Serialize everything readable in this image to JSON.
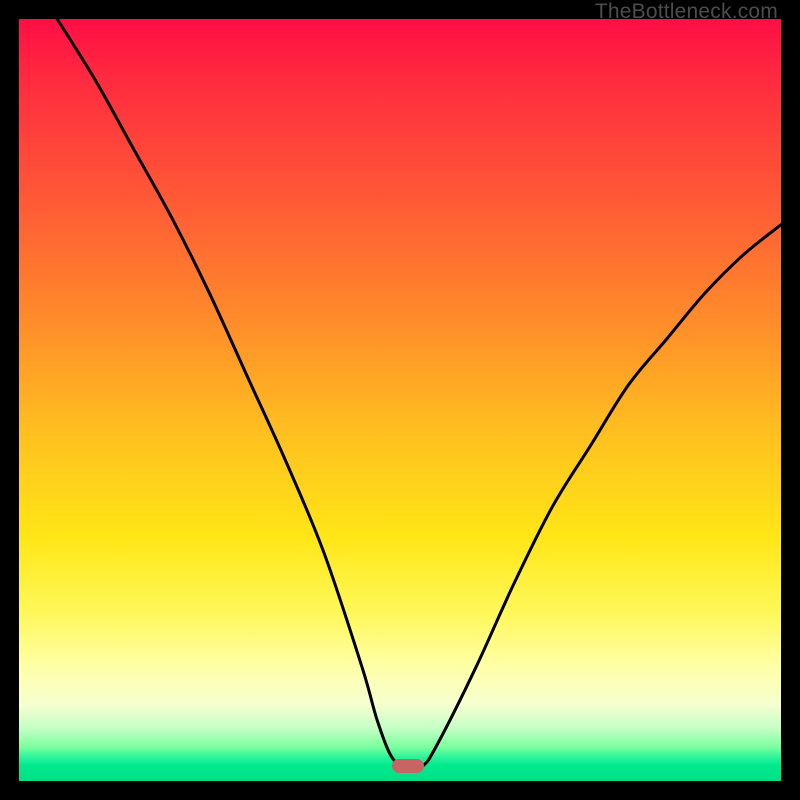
{
  "watermark": "TheBottleneck.com",
  "colors": {
    "frame": "#000000",
    "curve": "#000000",
    "marker": "#c86464",
    "gradient_top": "#ff0e45",
    "gradient_bottom": "#00e085"
  },
  "chart_data": {
    "type": "line",
    "title": "",
    "xlabel": "",
    "ylabel": "",
    "xlim": [
      0,
      100
    ],
    "ylim": [
      0,
      100
    ],
    "grid": false,
    "legend": false,
    "series": [
      {
        "name": "bottleneck-curve",
        "x": [
          5,
          10,
          15,
          20,
          25,
          30,
          35,
          40,
          45,
          47,
          49,
          51,
          53,
          55,
          60,
          65,
          70,
          75,
          80,
          85,
          90,
          95,
          100
        ],
        "y": [
          100,
          92,
          83,
          74,
          64,
          53,
          42,
          30,
          15,
          8,
          3,
          2,
          2,
          5,
          15,
          26,
          36,
          44,
          52,
          58,
          64,
          69,
          73
        ]
      }
    ],
    "annotations": [
      {
        "name": "optimal-marker",
        "x": 51,
        "y": 2
      }
    ]
  }
}
